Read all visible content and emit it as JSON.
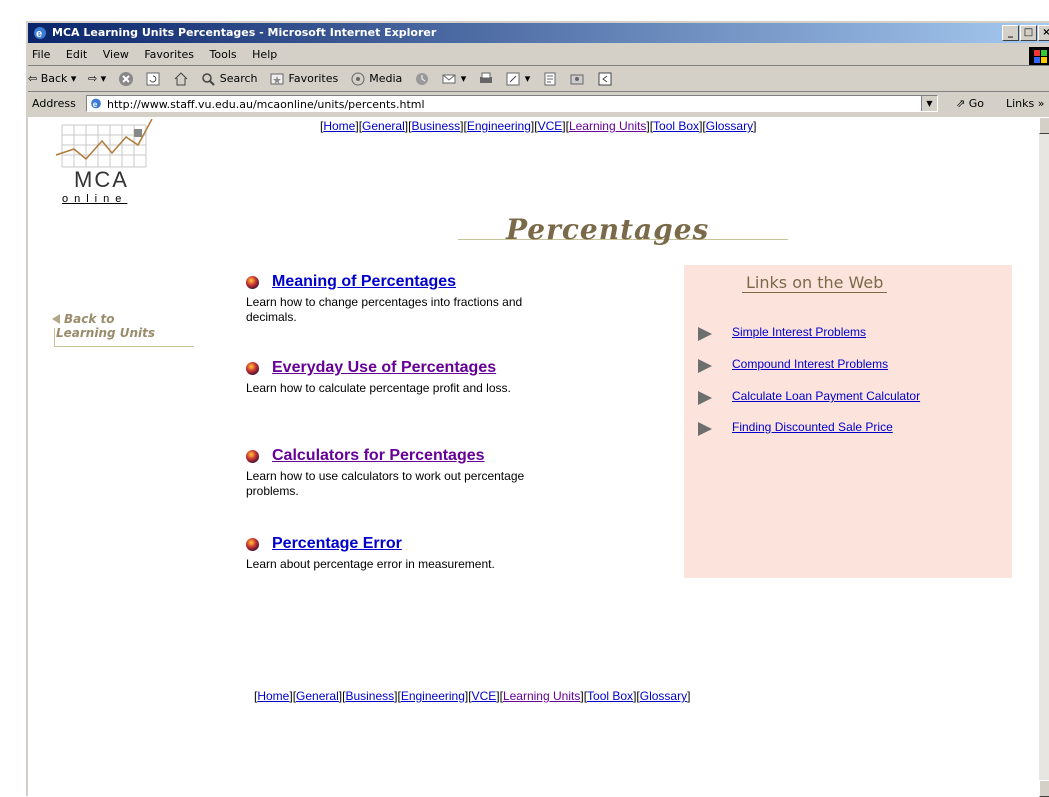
{
  "window": {
    "title": "MCA Learning Units Percentages - Microsoft Internet Explorer",
    "controls": [
      "_",
      "□",
      "×"
    ]
  },
  "menu": [
    "File",
    "Edit",
    "View",
    "Favorites",
    "Tools",
    "Help"
  ],
  "toolbar": {
    "back": "Back",
    "search": "Search",
    "favorites": "Favorites",
    "media": "Media"
  },
  "address": {
    "label": "Address",
    "url": "http://www.staff.vu.edu.au/mcaonline/units/percents.html",
    "go": "Go",
    "links": "Links"
  },
  "logo": {
    "mca": "MCA",
    "online": "online"
  },
  "nav": {
    "items": [
      {
        "label": "Home",
        "visited": false
      },
      {
        "label": "General",
        "visited": false
      },
      {
        "label": "Business",
        "visited": false
      },
      {
        "label": "Engineering",
        "visited": false
      },
      {
        "label": "VCE",
        "visited": false
      },
      {
        "label": "Learning Units",
        "visited": true
      },
      {
        "label": "Tool Box",
        "visited": false
      },
      {
        "label": "Glossary",
        "visited": false
      }
    ]
  },
  "page_title": "Percentages",
  "back_link": {
    "line1": "Back to",
    "line2": "Learning Units"
  },
  "topics": [
    {
      "title": "Meaning of Percentages",
      "desc": "Learn how to change percentages into fractions and decimals.",
      "visited": false
    },
    {
      "title": "Everyday Use of Percentages",
      "desc": "Learn how to calculate percentage profit and loss.",
      "visited": true
    },
    {
      "title": "Calculators for Percentages",
      "desc": "Learn how to use calculators to work out percentage problems.",
      "visited": true
    },
    {
      "title": "Percentage Error",
      "desc": "Learn about percentage error in measurement.",
      "visited": false
    }
  ],
  "web_links": {
    "title": "Links on the Web",
    "items": [
      "Simple Interest Problems",
      "Compound Interest Problems",
      "Calculate Loan Payment Calculator",
      "Finding Discounted Sale Price"
    ]
  }
}
